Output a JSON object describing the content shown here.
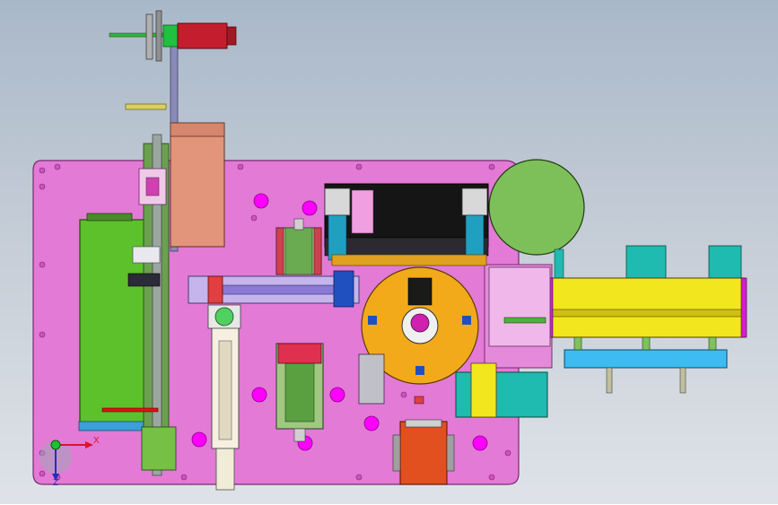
{
  "viewport": {
    "triad": {
      "x_label": "X",
      "z_label": "Z"
    }
  },
  "colors": {
    "background_top": "#a9b8c9",
    "background_bottom": "#dfe3e8",
    "base_plate": "#e27ad6",
    "green_frame": "#5cc12a",
    "salmon_block": "#e2957a",
    "orange_disk": "#f3aa1a",
    "round_plate": "#7dc05a",
    "yellow_rail": "#f2e61e",
    "cyan_bar": "#3cbcf0",
    "teal_block": "#1fbab0",
    "red_motor": "#c41e2e",
    "black_housing": "#151515"
  },
  "icons": [
    "coordinate-triad-icon"
  ]
}
